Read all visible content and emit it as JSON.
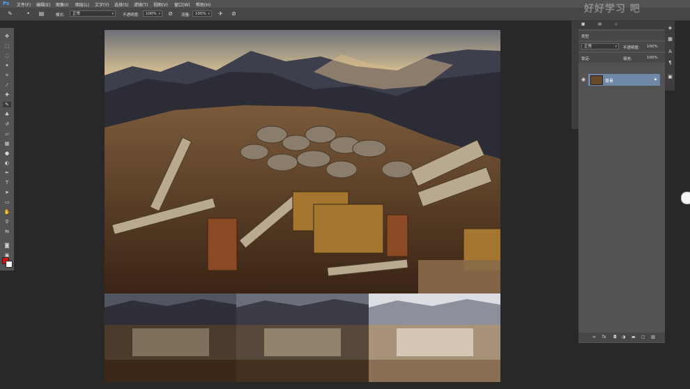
{
  "app": {
    "logo": "Ps"
  },
  "menubar": {
    "items": [
      "文件(F)",
      "编辑(E)",
      "图像(I)",
      "图层(L)",
      "文字(Y)",
      "选择(S)",
      "滤镜(T)",
      "视图(V)",
      "窗口(W)",
      "帮助(H)"
    ]
  },
  "options": {
    "mode_label": "模式:",
    "mode_value": "正常",
    "opacity_label": "不透明度:",
    "opacity_value": "100%",
    "flow_label": "流量:",
    "flow_value": "100%"
  },
  "layers": {
    "kind_label": "类型",
    "blend_mode": "正常",
    "opacity_label": "不透明度:",
    "opacity_value": "100%",
    "lock_label": "锁定:",
    "fill_label": "填充:",
    "fill_value": "100%",
    "items": [
      {
        "name": "背景",
        "visible": true,
        "locked": true
      }
    ]
  },
  "watermark": "好好学习 吧",
  "colors": {
    "foreground": "#e01010",
    "background": "#ffffff",
    "selected_layer": "#6f88a8"
  },
  "icons": [
    "brush-tool-icon",
    "move-tool-icon",
    "marquee-tool-icon",
    "lasso-tool-icon",
    "quick-select-icon",
    "crop-tool-icon",
    "eyedropper-icon",
    "healing-brush-icon",
    "brush-icon",
    "clone-stamp-icon",
    "history-brush-icon",
    "eraser-icon",
    "gradient-icon",
    "blur-icon",
    "dodge-icon",
    "pen-icon",
    "type-icon",
    "path-select-icon",
    "shape-icon",
    "hand-icon",
    "zoom-icon",
    "eye-icon",
    "lock-icon",
    "link-icon",
    "fx-icon",
    "mask-icon",
    "adjustment-icon",
    "folder-icon",
    "new-layer-icon",
    "trash-icon"
  ]
}
